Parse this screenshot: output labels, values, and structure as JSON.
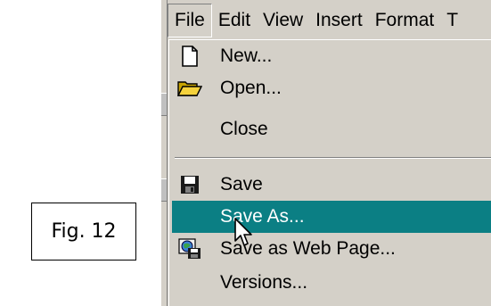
{
  "figure": {
    "label": "Fig. 12"
  },
  "menubar": {
    "items": [
      {
        "label": "File",
        "active": true
      },
      {
        "label": "Edit"
      },
      {
        "label": "View"
      },
      {
        "label": "Insert"
      },
      {
        "label": "Format"
      },
      {
        "label": "T"
      }
    ]
  },
  "file_menu": {
    "new": "New...",
    "open": "Open...",
    "close": "Close",
    "save": "Save",
    "save_as": "Save As...",
    "save_web": "Save as Web Page...",
    "versions": "Versions..."
  },
  "colors": {
    "highlight": "#0b7f84",
    "menu_bg": "#d4d0c8"
  },
  "icons": {
    "new": "new-document-icon",
    "open": "open-folder-icon",
    "save": "floppy-disk-icon",
    "save_web": "web-page-save-icon",
    "cursor": "mouse-pointer-icon"
  }
}
